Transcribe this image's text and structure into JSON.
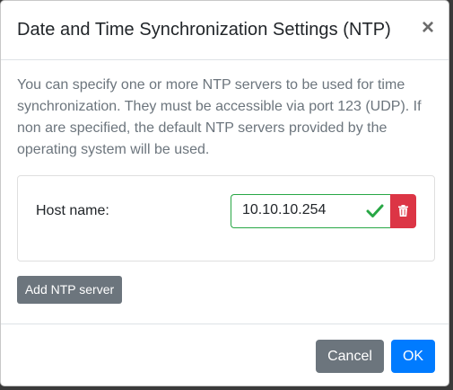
{
  "dialog": {
    "title": "Date and Time Synchronization Settings (NTP)",
    "close_label": "×"
  },
  "body": {
    "description": "You can specify one or more NTP servers to be used for time synchronization. They must be accessible via port 123 (UDP). If non are specified, the default NTP servers provided by the operating system will be used.",
    "servers": [
      {
        "label": "Host name:",
        "value": "10.10.10.254",
        "status": "valid"
      }
    ],
    "add_server_label": "Add NTP server"
  },
  "footer": {
    "cancel_label": "Cancel",
    "ok_label": "OK"
  },
  "colors": {
    "valid": "#28a745",
    "danger": "#dc3545",
    "secondary": "#6c757d",
    "primary": "#007bff"
  },
  "icons": {
    "valid": "check-icon",
    "delete": "trash-icon",
    "close": "close-icon"
  }
}
